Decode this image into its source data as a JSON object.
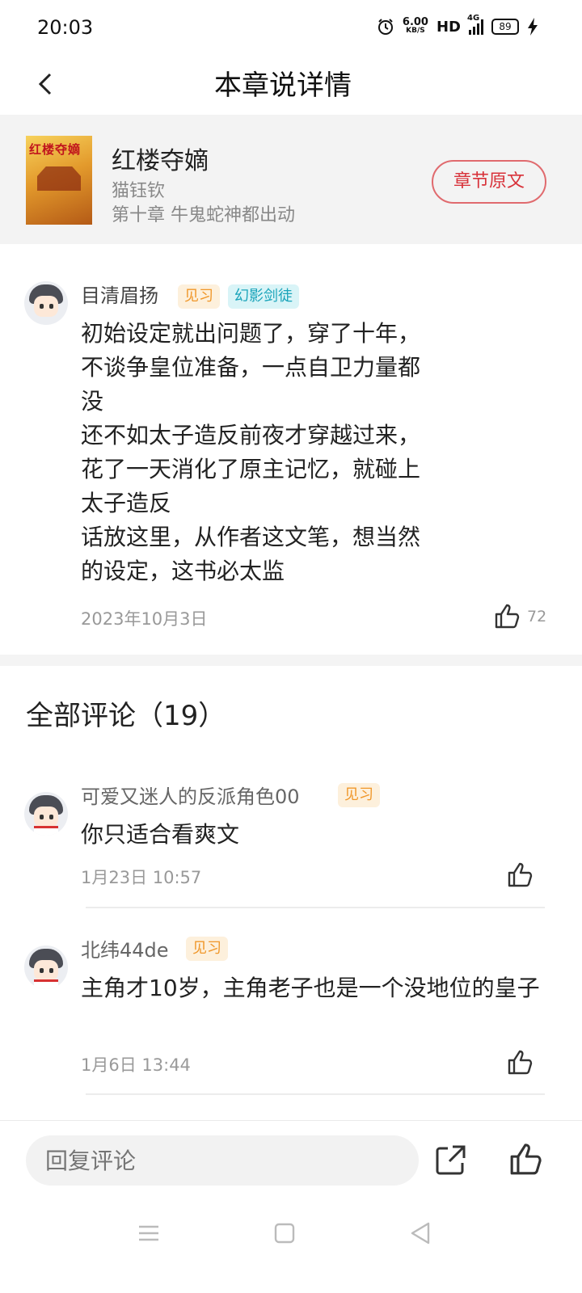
{
  "status_bar": {
    "time": "20:03",
    "speed_value": "6.00",
    "speed_unit": "KB/S",
    "hd": "HD",
    "network": "4G",
    "battery": "89"
  },
  "header": {
    "title": "本章说详情"
  },
  "book": {
    "cover_text": "红楼夺嫡",
    "title": "红楼夺嫡",
    "author": "猫钰钦",
    "chapter": "第十章 牛鬼蛇神都出动",
    "chapter_button": "章节原文"
  },
  "main_comment": {
    "username": "目清眉扬",
    "badges": [
      "见习",
      "幻影剑徒"
    ],
    "text": "初始设定就出问题了，穿了十年，\n不谈争皇位准备，一点自卫力量都\n没\n还不如太子造反前夜才穿越过来，\n花了一天消化了原主记忆，就碰上\n太子造反\n话放这里，从作者这文笔，想当然\n的设定，这书必太监",
    "date": "2023年10月3日",
    "likes": "72"
  },
  "comments_section": {
    "title": "全部评论（19）",
    "items": [
      {
        "username": "可爱又迷人的反派角色00",
        "badge": "见习",
        "text": "你只适合看爽文",
        "time": "1月23日 10:57"
      },
      {
        "username": "北纬44de",
        "badge": "见习",
        "text": "主角才10岁，主角老子也是一个没地位的皇子",
        "time": "1月6日 13:44"
      }
    ]
  },
  "bottom_bar": {
    "reply_placeholder": "回复评论"
  },
  "colors": {
    "accent_red": "#d8323a",
    "badge_orange": "#f0972a",
    "badge_cyan": "#1aa4ba"
  },
  "icons": [
    "back-arrow-icon",
    "alarm-icon",
    "signal-icon",
    "battery-icon",
    "charging-icon",
    "thumbs-up-icon",
    "share-icon",
    "menu-icon",
    "home-square-icon",
    "back-triangle-icon"
  ]
}
